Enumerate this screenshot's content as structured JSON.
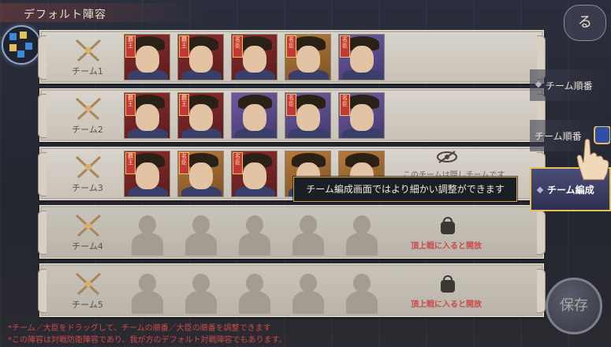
{
  "header": {
    "title": "デフォルト陣容"
  },
  "teams": [
    {
      "label": "チーム1",
      "status": "",
      "slots": [
        {
          "type": "hero",
          "rarity": "red",
          "badge": "覇王"
        },
        {
          "type": "hero",
          "rarity": "red",
          "badge": "覇王"
        },
        {
          "type": "hero",
          "rarity": "red",
          "badge": "名臣"
        },
        {
          "type": "hero",
          "rarity": "orange",
          "badge": "名臣"
        },
        {
          "type": "hero",
          "rarity": "purple",
          "badge": "名臣"
        }
      ]
    },
    {
      "label": "チーム2",
      "status": "",
      "slots": [
        {
          "type": "hero",
          "rarity": "red",
          "badge": "覇王"
        },
        {
          "type": "hero",
          "rarity": "red",
          "badge": "覇王"
        },
        {
          "type": "hero",
          "rarity": "purple",
          "badge": ""
        },
        {
          "type": "hero",
          "rarity": "purple",
          "badge": "名臣"
        },
        {
          "type": "hero",
          "rarity": "purple",
          "badge": "名臣"
        }
      ]
    },
    {
      "label": "チーム3",
      "status": "このチームは隠しチームです",
      "slots": [
        {
          "type": "hero",
          "rarity": "red",
          "badge": "覇王"
        },
        {
          "type": "hero",
          "rarity": "orange",
          "badge": "名臣"
        },
        {
          "type": "hero",
          "rarity": "red",
          "badge": "名臣"
        },
        {
          "type": "hero",
          "rarity": "orange",
          "badge": ""
        },
        {
          "type": "hero",
          "rarity": "orange",
          "badge": ""
        }
      ]
    },
    {
      "label": "チーム4",
      "status": "頂上戦に入ると開放",
      "slots": [
        {
          "type": "empty"
        },
        {
          "type": "empty"
        },
        {
          "type": "empty"
        },
        {
          "type": "empty"
        },
        {
          "type": "empty"
        }
      ]
    },
    {
      "label": "チーム5",
      "status": "頂上戦に入ると開放",
      "slots": [
        {
          "type": "empty"
        },
        {
          "type": "empty"
        },
        {
          "type": "empty"
        },
        {
          "type": "empty"
        },
        {
          "type": "empty"
        }
      ]
    }
  ],
  "sidebar": {
    "buttons": [
      {
        "label": "チーム順番"
      },
      {
        "label": "チーム順番"
      },
      {
        "label": "チーム編成"
      }
    ],
    "save_label": "保存",
    "emblem_text": "る"
  },
  "tooltip": {
    "text": "チーム編成画面ではより細かい調整ができます"
  },
  "notes": [
    "*チーム／大臣をドラッグして、チームの順番／大臣の順番を調整できます",
    "*この陣容は対戦防衛陣容であり、我が方のデフォルト対戦陣容でもあります。"
  ],
  "colors": {
    "accent_gold": "#e2c15a",
    "status_red": "#c94b4b",
    "tooltip_border": "#c9a959"
  }
}
